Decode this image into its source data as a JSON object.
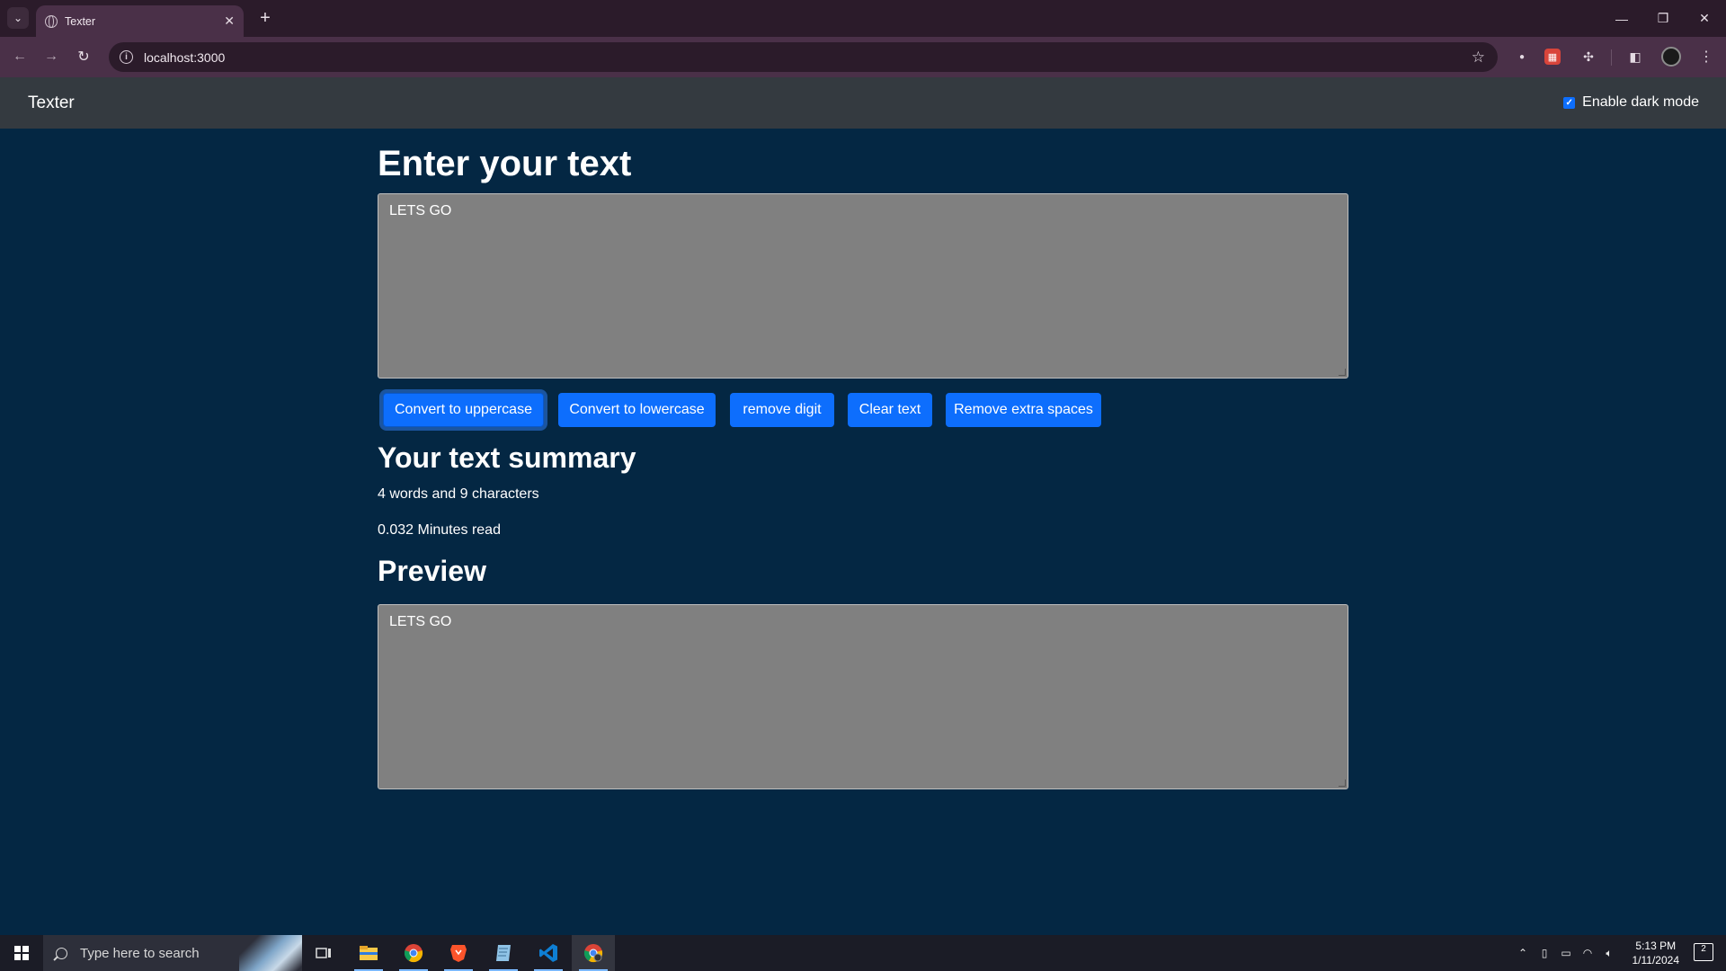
{
  "browser": {
    "tab_title": "Texter",
    "tab_close": "✕",
    "new_tab": "+",
    "tab_search": "⌄",
    "url": "localhost:3000",
    "back": "←",
    "forward": "→",
    "reload": "↻",
    "star": "☆",
    "window": {
      "minimize": "—",
      "restore": "❐",
      "close": "✕"
    },
    "toolbar_icons": [
      "puzzle-extension-icon",
      "sidebar-icon",
      "profile-avatar-icon",
      "kebab-menu-icon"
    ]
  },
  "navbar": {
    "brand": "Texter",
    "dark_mode_label": "Enable dark mode",
    "dark_mode_checked": true
  },
  "main": {
    "heading": "Enter your text",
    "input_text": "LETS GO",
    "buttons": {
      "uppercase": "Convert to uppercase",
      "lowercase": "Convert to lowercase",
      "remove_digit": "remove digit",
      "clear": "Clear text",
      "remove_spaces": "Remove extra spaces"
    },
    "summary_heading": "Your text summary",
    "summary_counts": "4 words and 9 characters",
    "read_time": "0.032 Minutes read",
    "preview_heading": "Preview",
    "preview_text": "LETS GO"
  },
  "taskbar": {
    "search_placeholder": "Type here to search",
    "time": "5:13 PM",
    "date": "1/11/2024",
    "notification_count": "2",
    "apps": [
      "task-view-icon",
      "file-explorer-icon",
      "chrome-icon",
      "brave-icon",
      "notepad-icon",
      "vscode-icon",
      "chrome-active-icon"
    ]
  },
  "colors": {
    "page_bg": "#042743",
    "navbar_bg": "#343a40",
    "button_bg": "#0d6efd",
    "textarea_bg": "#808080",
    "browser_frame": "#4a3048"
  }
}
